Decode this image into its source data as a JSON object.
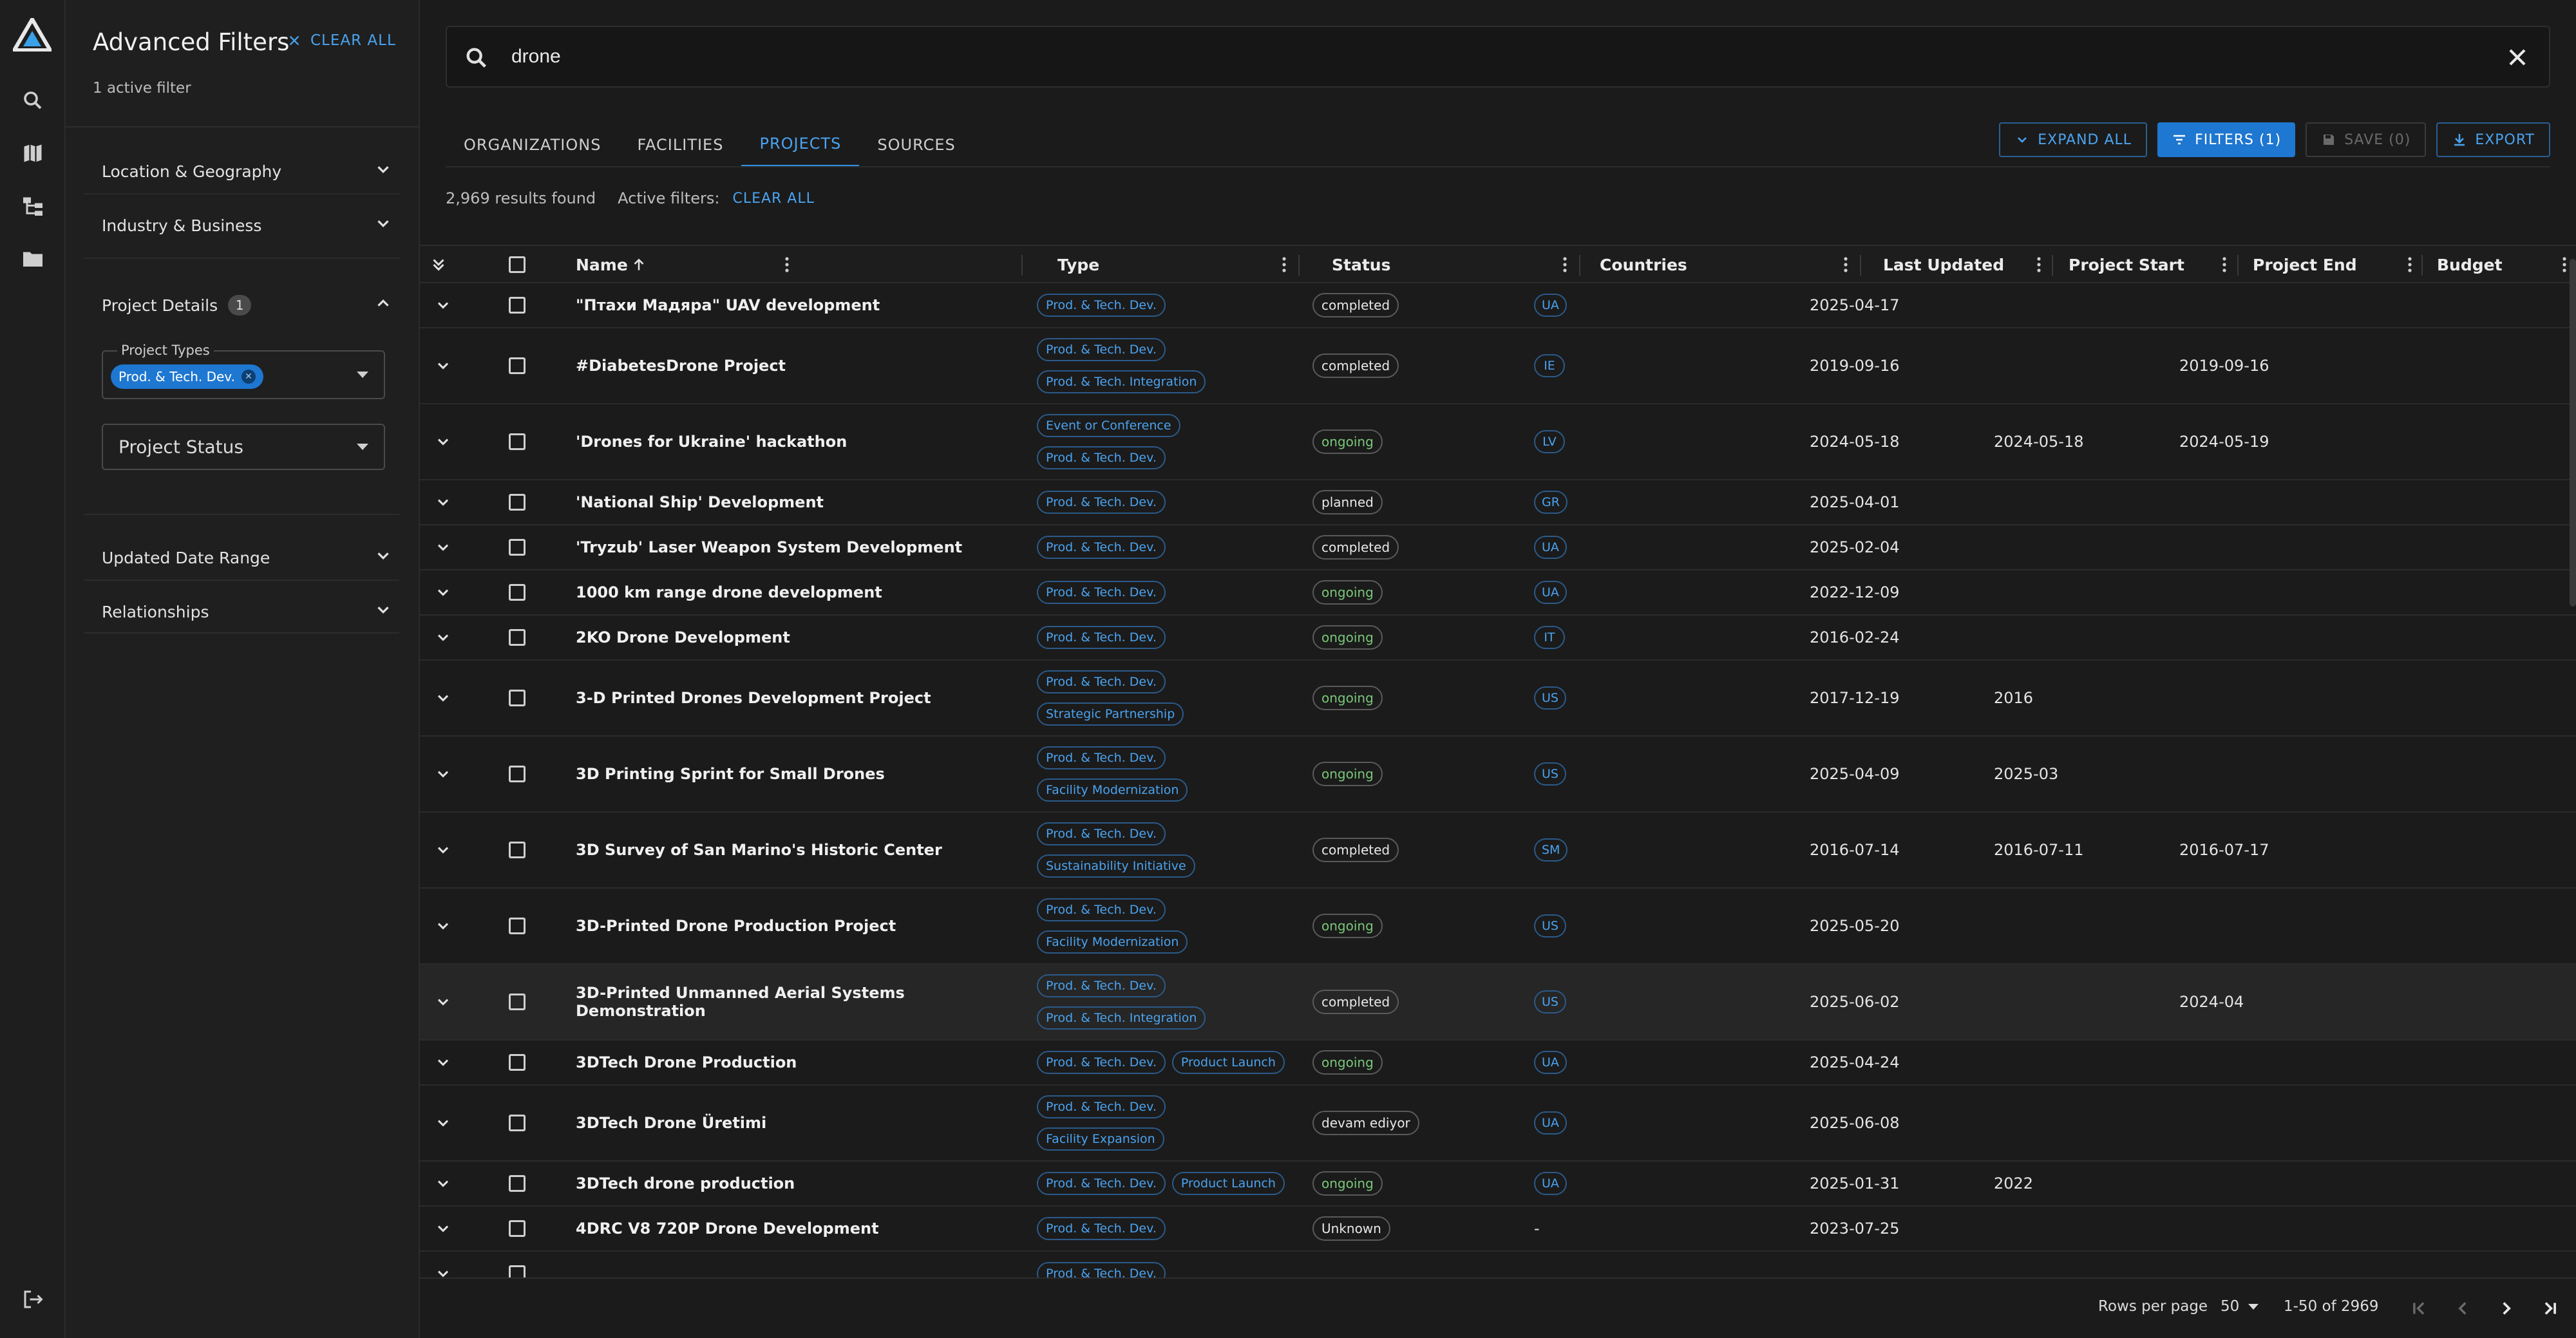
{
  "sidebar": {
    "icons": [
      "logo-icon",
      "search-icon",
      "map-icon",
      "hierarchy-icon",
      "folder-icon",
      "logout-icon"
    ]
  },
  "filters": {
    "title": "Advanced Filters",
    "clear_all": "CLEAR ALL",
    "active_count_text": "1 active filter",
    "sections": {
      "location": "Location & Geography",
      "industry": "Industry & Business",
      "project_details": "Project Details",
      "project_details_badge": "1",
      "updated_range": "Updated Date Range",
      "relationships": "Relationships"
    },
    "project_types_label": "Project Types",
    "project_types_chip": "Prod. & Tech. Dev.",
    "project_status_placeholder": "Project Status"
  },
  "search": {
    "value": "drone"
  },
  "tabs": [
    "ORGANIZATIONS",
    "FACILITIES",
    "PROJECTS",
    "SOURCES"
  ],
  "active_tab": "PROJECTS",
  "toolbar": {
    "expand_all": "EXPAND ALL",
    "filters": "FILTERS (1)",
    "save": "SAVE (0)",
    "export": "EXPORT"
  },
  "results": {
    "count_text": "2,969 results found",
    "active_filters_label": "Active filters:",
    "clear_all": "CLEAR ALL"
  },
  "table": {
    "columns": [
      "Name",
      "Type",
      "Status",
      "Countries",
      "Last Updated",
      "Project Start",
      "Project End",
      "Budget"
    ],
    "rows": [
      {
        "name": "\"Птахи Мадяра\" UAV development",
        "types": [
          [
            "Prod. & Tech. Dev."
          ]
        ],
        "status": "completed",
        "country": "UA",
        "updated": "2025-04-17",
        "start": "",
        "end": ""
      },
      {
        "name": "#DiabetesDrone Project",
        "types": [
          [
            "Prod. & Tech. Dev."
          ],
          [
            "Prod. & Tech. Integration"
          ]
        ],
        "status": "completed",
        "country": "IE",
        "updated": "2019-09-16",
        "start": "",
        "end": "2019-09-16"
      },
      {
        "name": "'Drones for Ukraine' hackathon",
        "types": [
          [
            "Event or Conference"
          ],
          [
            "Prod. & Tech. Dev."
          ]
        ],
        "status": "ongoing",
        "country": "LV",
        "updated": "2024-05-18",
        "start": "2024-05-18",
        "end": "2024-05-19"
      },
      {
        "name": "'National Ship' Development",
        "types": [
          [
            "Prod. & Tech. Dev."
          ]
        ],
        "status": "planned",
        "country": "GR",
        "updated": "2025-04-01",
        "start": "",
        "end": ""
      },
      {
        "name": "'Tryzub' Laser Weapon System Development",
        "types": [
          [
            "Prod. & Tech. Dev."
          ]
        ],
        "status": "completed",
        "country": "UA",
        "updated": "2025-02-04",
        "start": "",
        "end": ""
      },
      {
        "name": "1000 km range drone development",
        "types": [
          [
            "Prod. & Tech. Dev."
          ]
        ],
        "status": "ongoing",
        "country": "UA",
        "updated": "2022-12-09",
        "start": "",
        "end": ""
      },
      {
        "name": "2KO Drone Development",
        "types": [
          [
            "Prod. & Tech. Dev."
          ]
        ],
        "status": "ongoing",
        "country": "IT",
        "updated": "2016-02-24",
        "start": "",
        "end": ""
      },
      {
        "name": "3-D Printed Drones Development Project",
        "types": [
          [
            "Prod. & Tech. Dev."
          ],
          [
            "Strategic Partnership"
          ]
        ],
        "status": "ongoing",
        "country": "US",
        "updated": "2017-12-19",
        "start": "2016",
        "end": ""
      },
      {
        "name": "3D Printing Sprint for Small Drones",
        "types": [
          [
            "Prod. & Tech. Dev."
          ],
          [
            "Facility Modernization"
          ]
        ],
        "status": "ongoing",
        "country": "US",
        "updated": "2025-04-09",
        "start": "2025-03",
        "end": ""
      },
      {
        "name": "3D Survey of San Marino's Historic Center",
        "types": [
          [
            "Prod. & Tech. Dev."
          ],
          [
            "Sustainability Initiative"
          ]
        ],
        "status": "completed",
        "country": "SM",
        "updated": "2016-07-14",
        "start": "2016-07-11",
        "end": "2016-07-17"
      },
      {
        "name": "3D-Printed Drone Production Project",
        "types": [
          [
            "Prod. & Tech. Dev."
          ],
          [
            "Facility Modernization"
          ]
        ],
        "status": "ongoing",
        "country": "US",
        "updated": "2025-05-20",
        "start": "",
        "end": ""
      },
      {
        "name": "3D-Printed Unmanned Aerial Systems Demonstration",
        "types": [
          [
            "Prod. & Tech. Dev."
          ],
          [
            "Prod. & Tech. Integration"
          ]
        ],
        "status": "completed",
        "country": "US",
        "updated": "2025-06-02",
        "start": "",
        "end": "2024-04"
      },
      {
        "name": "3DTech Drone Production",
        "types": [
          [
            "Prod. & Tech. Dev.",
            "Product Launch"
          ]
        ],
        "status": "ongoing",
        "country": "UA",
        "updated": "2025-04-24",
        "start": "",
        "end": ""
      },
      {
        "name": "3DTech Drone Üretimi",
        "types": [
          [
            "Prod. & Tech. Dev."
          ],
          [
            "Facility Expansion"
          ]
        ],
        "status": "devam ediyor",
        "country": "UA",
        "updated": "2025-06-08",
        "start": "",
        "end": ""
      },
      {
        "name": "3DTech drone production",
        "types": [
          [
            "Prod. & Tech. Dev.",
            "Product Launch"
          ]
        ],
        "status": "ongoing",
        "country": "UA",
        "updated": "2025-01-31",
        "start": "2022",
        "end": ""
      },
      {
        "name": "4DRC V8 720P Drone Development",
        "types": [
          [
            "Prod. & Tech. Dev."
          ]
        ],
        "status": "Unknown",
        "country": "-",
        "updated": "2023-07-25",
        "start": "",
        "end": ""
      },
      {
        "name": "",
        "types": [
          [
            "Prod. & Tech. Dev."
          ]
        ],
        "status": "",
        "country": "",
        "updated": "",
        "start": "",
        "end": ""
      }
    ]
  },
  "pagination": {
    "rows_per_page_label": "Rows per page",
    "rows_per_page": "50",
    "range": "1-50 of 2969"
  },
  "colors": {
    "accent": "#1e77d0",
    "link": "#4aa3f0",
    "bg": "#1b1b1b",
    "ongoing": "#7ac77a"
  }
}
